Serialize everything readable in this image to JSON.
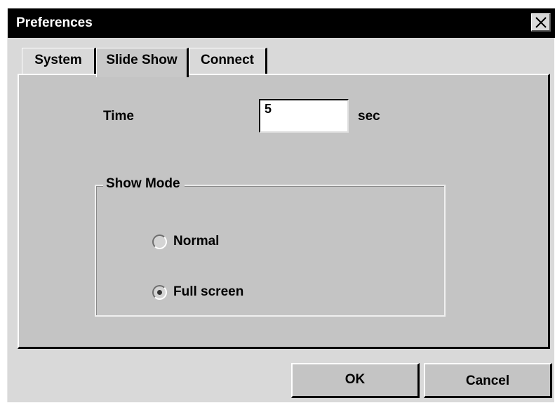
{
  "window": {
    "title": "Preferences",
    "close_icon": "close-x-icon"
  },
  "tabs": [
    {
      "label": "System",
      "active": false
    },
    {
      "label": "Slide Show",
      "active": true
    },
    {
      "label": "Connect",
      "active": false
    }
  ],
  "slideshow": {
    "time_label": "Time",
    "time_value": "5",
    "time_unit": "sec",
    "show_mode": {
      "legend": "Show Mode",
      "options": [
        {
          "label": "Normal",
          "selected": false
        },
        {
          "label": "Full screen",
          "selected": true
        }
      ]
    }
  },
  "buttons": {
    "ok": "OK",
    "cancel": "Cancel"
  },
  "colors": {
    "titlebar": "#000000",
    "dialog_bg": "#d9d9d9",
    "panel_bg": "#c4c4c4"
  }
}
